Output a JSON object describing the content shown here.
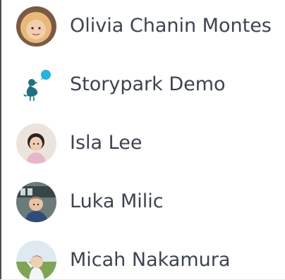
{
  "children": [
    {
      "name": "Olivia Chanin Montes",
      "avatar": "child-photo-avatar"
    },
    {
      "name": "Storypark Demo",
      "avatar": "storypark-bird-logo-icon"
    },
    {
      "name": "Isla Lee",
      "avatar": "child-photo-avatar"
    },
    {
      "name": "Luka Milic",
      "avatar": "child-photo-avatar"
    },
    {
      "name": "Micah Nakamura",
      "avatar": "child-photo-avatar"
    }
  ],
  "colors": {
    "name_text": "#3d4450",
    "left_rule": "#4a4f57",
    "logo_teal": "#1f6f80",
    "logo_bubble": "#26b3dc"
  }
}
